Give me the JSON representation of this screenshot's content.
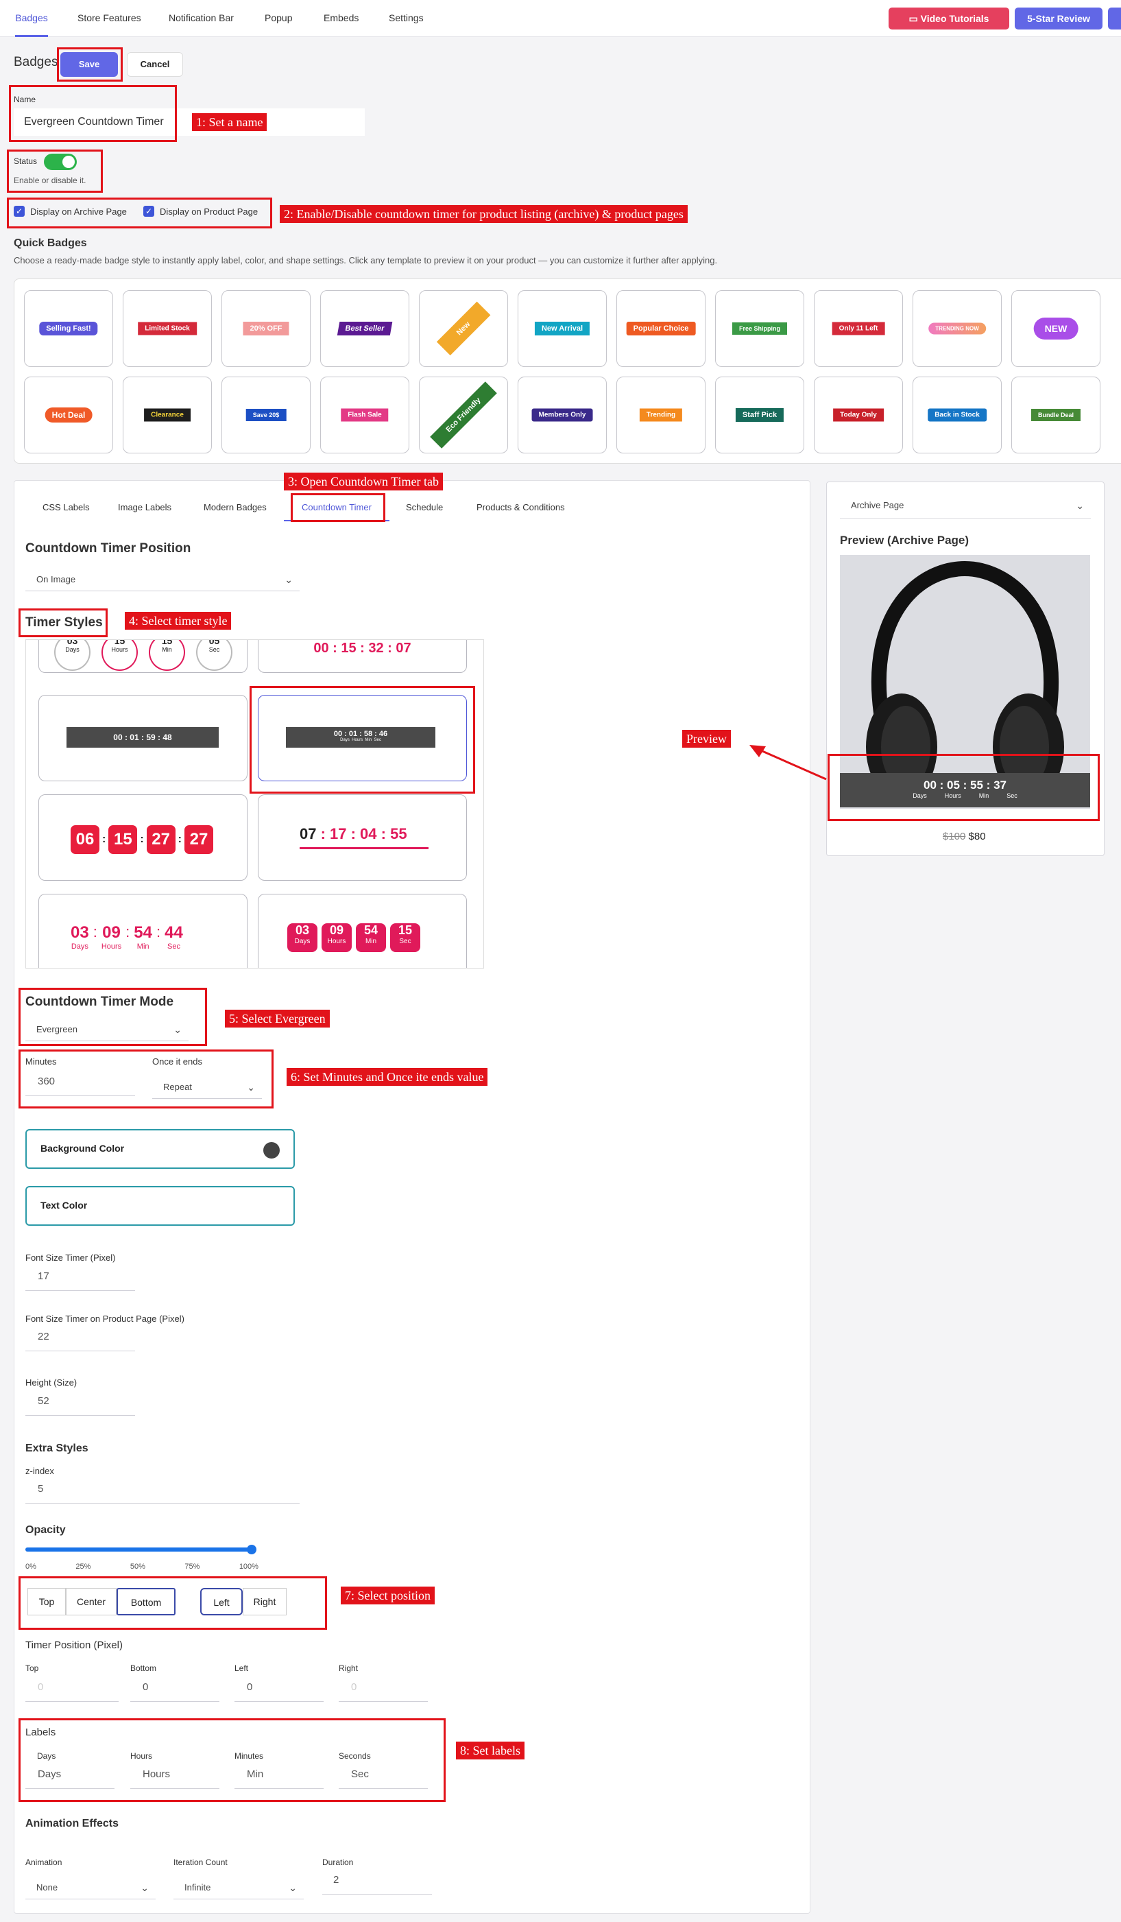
{
  "topnav": {
    "tabs": [
      "Badges",
      "Store Features",
      "Notification Bar",
      "Popup",
      "Embeds",
      "Settings"
    ],
    "video_tutorials": "Video Tutorials",
    "review": "5-Star Review"
  },
  "header": {
    "title": "Badges",
    "save": "Save",
    "cancel": "Cancel"
  },
  "name": {
    "label": "Name",
    "value": "Evergreen Countdown Timer"
  },
  "status": {
    "label": "Status",
    "help": "Enable or disable it."
  },
  "display": {
    "archive": "Display on Archive Page",
    "product": "Display on Product Page"
  },
  "quick": {
    "title": "Quick Badges",
    "desc": "Choose a ready-made badge style to instantly apply label, color, and shape settings. Click any template to preview it on your product — you can customize it further after applying.",
    "row1": [
      "Selling Fast!",
      "Limited Stock",
      "20% OFF",
      "Best Seller",
      "New",
      "New Arrival",
      "Popular Choice",
      "Free Shipping",
      "Only 11 Left",
      "TRENDING NOW",
      "NEW"
    ],
    "row2": [
      "Hot Deal",
      "Clearance",
      "Save 20$",
      "Flash Sale",
      "Eco Friendly",
      "Members Only",
      "Trending",
      "Staff Pick",
      "Today Only",
      "Back in Stock",
      "Bundle Deal"
    ]
  },
  "tabs": [
    "CSS Labels",
    "Image Labels",
    "Modern Badges",
    "Countdown Timer",
    "Schedule",
    "Products & Conditions"
  ],
  "position": {
    "title": "Countdown Timer Position",
    "value": "On Image"
  },
  "styles": {
    "title": "Timer Styles",
    "t_top_left": [
      "03",
      "15",
      "15",
      "05"
    ],
    "t_top_left_units": [
      "Days",
      "Hours",
      "Min",
      "Sec"
    ],
    "t_top_right": "00 : 15 : 32 : 07",
    "t1": "00 : 01 : 59 : 48",
    "t2": "00 : 01 : 58 : 46",
    "t2_units": "Days  Hours  Min  Sec",
    "t3": [
      "06",
      "15",
      "27",
      "27"
    ],
    "t4_day": "07",
    "t4_rest": " : 17 : 04 : 55",
    "t5": [
      "03",
      "09",
      "54",
      "44"
    ],
    "t5_units": [
      "Days",
      "Hours",
      "Min",
      "Sec"
    ],
    "t6": [
      "03",
      "09",
      "54",
      "15"
    ],
    "t6_units": [
      "Days",
      "Hours",
      "Min",
      "Sec"
    ]
  },
  "mode": {
    "title": "Countdown Timer Mode",
    "value": "Evergreen"
  },
  "minutes": {
    "label": "Minutes",
    "value": "360",
    "ends_label": "Once it ends",
    "ends_value": "Repeat"
  },
  "colors": {
    "bg": "Background Color",
    "text": "Text Color",
    "bg_swatch": "#444444"
  },
  "font_size": {
    "label": "Font Size Timer (Pixel)",
    "value": "17"
  },
  "font_size_product": {
    "label": "Font Size Timer on Product Page (Pixel)",
    "value": "22"
  },
  "height": {
    "label": "Height (Size)",
    "value": "52"
  },
  "extra": {
    "title": "Extra Styles",
    "zlabel": "z-index",
    "zvalue": "5"
  },
  "opacity": {
    "title": "Opacity",
    "value": 1.0,
    "ticks": [
      "0%",
      "25%",
      "50%",
      "75%",
      "100%"
    ]
  },
  "vpos": [
    "Top",
    "Center",
    "Bottom"
  ],
  "hpos": [
    "Left",
    "Right"
  ],
  "timerpos": {
    "title": "Timer Position (Pixel)",
    "labels": [
      "Top",
      "Bottom",
      "Left",
      "Right"
    ],
    "values": [
      "0",
      "0",
      "0",
      "0"
    ]
  },
  "labels": {
    "title": "Labels",
    "fields": [
      "Days",
      "Hours",
      "Minutes",
      "Seconds"
    ],
    "values": [
      "Days",
      "Hours",
      "Min",
      "Sec"
    ]
  },
  "anim": {
    "title": "Animation Effects",
    "a_label": "Animation",
    "a_value": "None",
    "i_label": "Iteration Count",
    "i_value": "Infinite",
    "d_label": "Duration",
    "d_value": "2"
  },
  "preview": {
    "select": "Archive Page",
    "title": "Preview (Archive Page)",
    "timer": "00 : 05 : 55 : 37",
    "units": [
      "Days",
      "Hours",
      "Min",
      "Sec"
    ],
    "old_price": "$100",
    "price": "$80"
  },
  "annotations": [
    "1: Set a name",
    "2: Enable/Disable countdown timer for product listing (archive) & product pages",
    "3: Open Countdown Timer tab",
    "4: Select timer style",
    "Preview",
    "5: Select Evergreen",
    "6: Set Minutes and Once ite ends value",
    "7: Select position",
    "8: Set labels"
  ]
}
